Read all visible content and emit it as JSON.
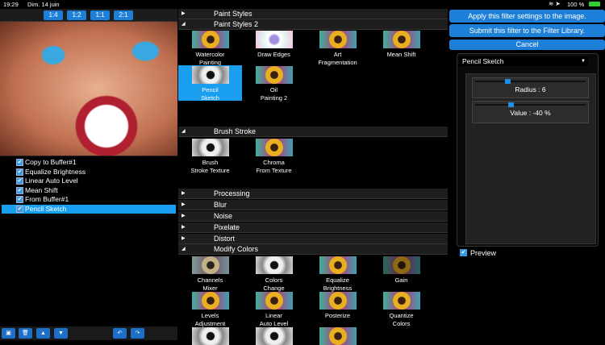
{
  "status": {
    "time": "19:29",
    "date": "Dim. 14 juin",
    "battery": "100 %"
  },
  "zoom_buttons": [
    "1:4",
    "1:2",
    "1:1",
    "2:1"
  ],
  "filter_stack": [
    {
      "label": "Copy to Buffer#1",
      "checked": true
    },
    {
      "label": "Equalize Brightness",
      "checked": true
    },
    {
      "label": "Linear Auto Level",
      "checked": true
    },
    {
      "label": "Mean Shift",
      "checked": true
    },
    {
      "label": "From Buffer#1",
      "checked": true
    },
    {
      "label": "Pencil Sketch",
      "checked": true,
      "selected": true
    }
  ],
  "categories": {
    "paint_styles": "Paint Styles",
    "paint_styles_2": "Paint Styles 2",
    "brush_stroke": "Brush Stroke",
    "processing": "Processing",
    "blur": "Blur",
    "noise": "Noise",
    "pixelate": "Pixelate",
    "distort": "Distort",
    "modify_colors": "Modify Colors"
  },
  "paint_styles_2_items": [
    [
      "Watercolor",
      "Painting"
    ],
    [
      "Draw Edges",
      ""
    ],
    [
      "Art",
      "Fragmentation"
    ],
    [
      "Mean Shift",
      ""
    ],
    [
      "Pencil",
      "Sketch"
    ],
    [
      "Oil",
      "Painting 2"
    ]
  ],
  "brush_stroke_items": [
    [
      "Brush",
      "Stroke Texture"
    ],
    [
      "Chroma",
      "From Texture"
    ]
  ],
  "modify_colors_items": [
    [
      "Channels",
      "Mixer"
    ],
    [
      "Colors",
      "Change"
    ],
    [
      "Equalize",
      "Brightness"
    ],
    [
      "Gain",
      ""
    ],
    [
      "Levels",
      "Adjustment"
    ],
    [
      "Linear",
      "Auto Level"
    ],
    [
      "Posterize",
      ""
    ],
    [
      "Quantize",
      "Colors"
    ]
  ],
  "right": {
    "apply": "Apply this filter settings to the image.",
    "submit": "Submit this filter to the Filter Library.",
    "cancel": "Cancel",
    "filter_select": "Pencil Sketch",
    "radius_label": "Radius : 6",
    "radius_fraction": 0.27,
    "value_label": "Value : -40 %",
    "value_fraction": 0.3,
    "preview": "Preview"
  }
}
